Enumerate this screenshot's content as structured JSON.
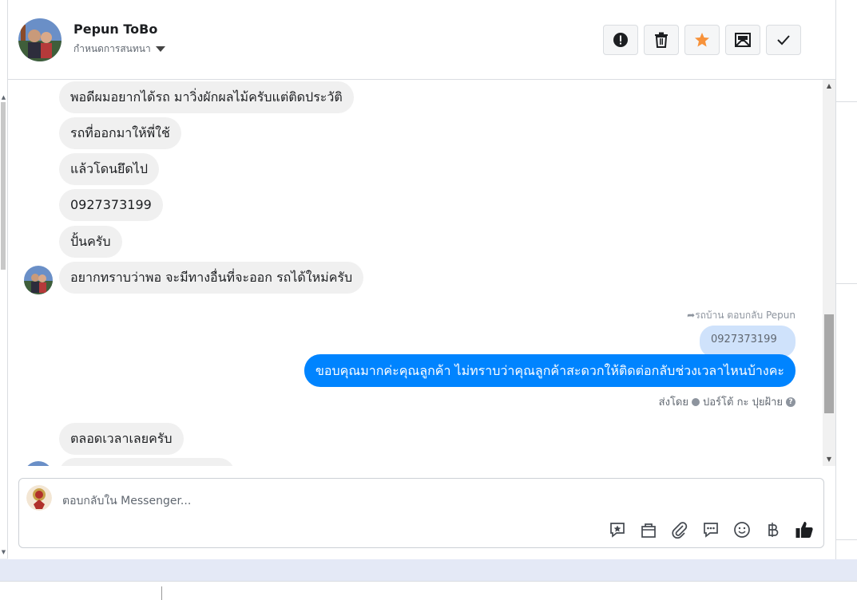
{
  "header": {
    "contact_name": "Pepun ToBo",
    "conversation_settings": "กำหนดการสนทนา",
    "actions": [
      {
        "name": "mark-spam",
        "icon": "exclamation-circle-icon"
      },
      {
        "name": "delete",
        "icon": "trash-icon"
      },
      {
        "name": "star",
        "icon": "star-icon"
      },
      {
        "name": "mark-unread",
        "icon": "envelope-icon"
      },
      {
        "name": "mark-done",
        "icon": "check-icon"
      }
    ]
  },
  "messages": {
    "incoming": [
      "พอดีผมอยากได้รถ มาวิ่งผักผลไม้ครับแต่ติดประวัติ",
      "รถที่ออกมาให้พี่ใช้",
      "แล้วโดนยึดไป",
      "0927373199",
      "ปั้นครับ",
      "อยากทราบว่าพอ จะมีทางอื่นที่จะออก รถได้ใหม่ครับ"
    ],
    "reply_meta": "รถบ้าน ตอบกลับ Pepun",
    "quoted": "0927373199",
    "outgoing": "ขอบคุณมากค่ะคุณลูกค้า ไม่ทราบว่าคุณลูกค้าสะดวกให้ติดต่อกลับช่วงเวลาไหนบ้างคะ",
    "sent_by_prefix": "ส่งโดย",
    "sent_by_name": "ปอร์โต้ กะ ปุยฝ้าย",
    "later_incoming": [
      "ตลอดเวลาเลยครับ"
    ]
  },
  "composer": {
    "placeholder": "ตอบกลับใน Messenger...",
    "tools": [
      "saved-reply-icon",
      "shopping-bag-icon",
      "paperclip-icon",
      "chat-bubble-icon",
      "emoji-icon",
      "baht-icon",
      "thumbs-up-icon"
    ]
  },
  "colors": {
    "outgoing_bubble": "#0084ff",
    "incoming_bubble": "#f0f0f0",
    "quoted_bubble": "#cfe2fb",
    "star": "#f7923a"
  }
}
